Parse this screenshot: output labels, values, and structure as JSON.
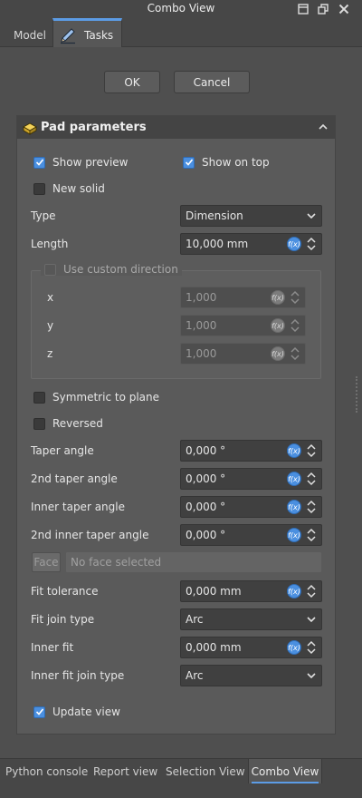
{
  "window": {
    "title": "Combo View"
  },
  "top_tabs": [
    {
      "label": "Model"
    },
    {
      "label": "Tasks"
    }
  ],
  "actions": {
    "ok_label": "OK",
    "cancel_label": "Cancel"
  },
  "panel": {
    "title": "Pad parameters",
    "show_preview": {
      "label": "Show preview",
      "checked": true
    },
    "show_on_top": {
      "label": "Show on top",
      "checked": true
    },
    "new_solid": {
      "label": "New solid",
      "checked": false
    },
    "type": {
      "label": "Type",
      "value": "Dimension"
    },
    "length": {
      "label": "Length",
      "value": "10,000 mm"
    },
    "custom_direction": {
      "label": "Use custom direction",
      "checked": false,
      "x": {
        "label": "x",
        "value": "1,000"
      },
      "y": {
        "label": "y",
        "value": "1,000"
      },
      "z": {
        "label": "z",
        "value": "1,000"
      }
    },
    "symmetric": {
      "label": "Symmetric to plane",
      "checked": false
    },
    "reversed": {
      "label": "Reversed",
      "checked": false
    },
    "taper_angle": {
      "label": "Taper angle",
      "value": "0,000 °"
    },
    "taper_angle_2": {
      "label": "2nd taper angle",
      "value": "0,000 °"
    },
    "inner_taper_angle": {
      "label": "Inner taper angle",
      "value": "0,000 °"
    },
    "inner_taper_angle_2": {
      "label": "2nd inner taper angle",
      "value": "0,000 °"
    },
    "face": {
      "button_label": "Face",
      "placeholder": "No face selected"
    },
    "fit_tolerance": {
      "label": "Fit tolerance",
      "value": "0,000 mm"
    },
    "fit_join_type": {
      "label": "Fit join type",
      "value": "Arc"
    },
    "inner_fit": {
      "label": "Inner fit",
      "value": "0,000 mm"
    },
    "inner_fit_join_type": {
      "label": "Inner fit join type",
      "value": "Arc"
    },
    "update_view": {
      "label": "Update view",
      "checked": true
    }
  },
  "bottom_tabs": [
    {
      "label": "Python console"
    },
    {
      "label": "Report view"
    },
    {
      "label": "Selection View"
    },
    {
      "label": "Combo View",
      "active": true
    }
  ],
  "colors": {
    "accent": "#4a8fe0",
    "background": "#4f4f4f",
    "panel": "#5a5a5a"
  }
}
